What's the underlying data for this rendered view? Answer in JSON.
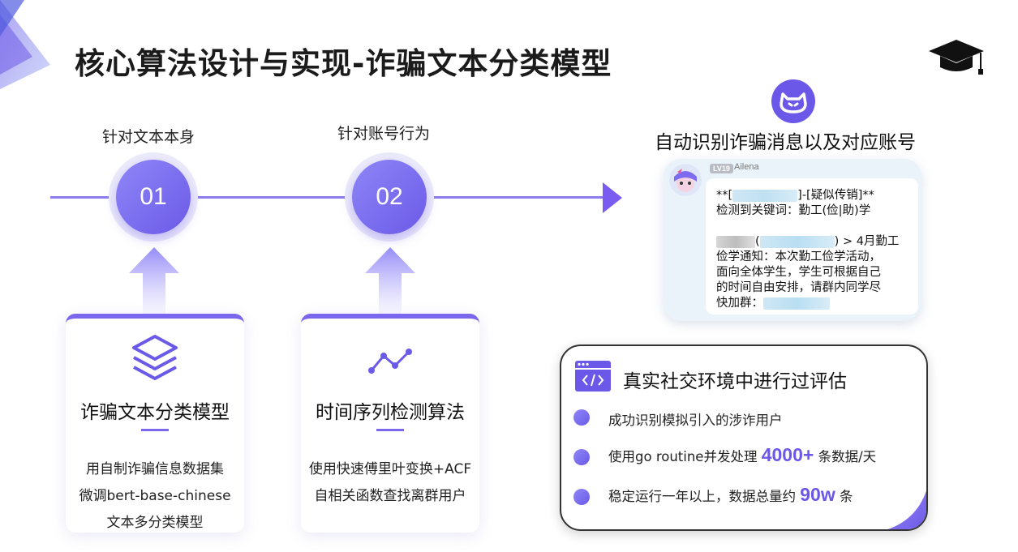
{
  "page": {
    "title": "核心算法设计与实现-诈骗文本分类模型"
  },
  "steps": [
    {
      "label": "针对文本本身",
      "number": "01"
    },
    {
      "label": "针对账号行为",
      "number": "02"
    }
  ],
  "cards": [
    {
      "icon": "layers-icon",
      "title": "诈骗文本分类模型",
      "lines": [
        "用自制诈骗信息数据集",
        "微调bert-base-chinese",
        "文本多分类模型"
      ]
    },
    {
      "icon": "line-chart-icon",
      "title": "时间序列检测算法",
      "lines": [
        "使用快速傅里叶变换+ACF",
        "自相关函数查找离群用户"
      ]
    }
  ],
  "right": {
    "title": "自动识别诈骗消息以及对应账号",
    "chat": {
      "level": "LV19",
      "user": "Ailena",
      "line1_prefix": "**[",
      "line1_suffix": "]-[疑似传销]**",
      "line2": "检测到关键词：勤工(俭|助)学",
      "line3_mid": "(",
      "line3_suffix": ") > 4月勤工",
      "line4": "俭学通知：本次勤工俭学活动，",
      "line5": "面向全体学生，学生可根据自己",
      "line6": "的时间自由安排，请群内同学尽",
      "line7_prefix": "快加群："
    }
  },
  "evaluation": {
    "title": "真实社交环境中进行过评估",
    "items": [
      {
        "text": "成功识别模拟引入的涉诈用户"
      },
      {
        "before": "使用go routine并发处理",
        "highlight": "4000+",
        "after": "条数据/天"
      },
      {
        "before": "稳定运行一年以上，数据总量约",
        "highlight": "90w",
        "after": "条"
      }
    ]
  },
  "colors": {
    "accent": "#7b67ee",
    "accent_dark": "#6b57e8",
    "line": "#8c7cf0"
  }
}
